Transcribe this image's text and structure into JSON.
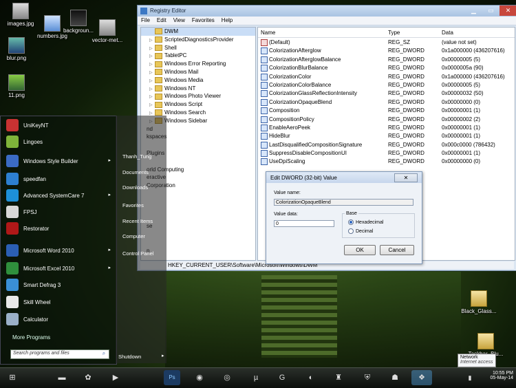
{
  "desktop_icons": [
    {
      "label": "images.jpg"
    },
    {
      "label": "numbers.jpg"
    },
    {
      "label": "backgroun..."
    },
    {
      "label": "vector-met..."
    },
    {
      "label": "blur.png"
    },
    {
      "label": "11.png"
    },
    {
      "label": "Black_Glass..."
    },
    {
      "label": "Taskbar_Blu..."
    }
  ],
  "regedit": {
    "title": "Registry Editor",
    "menu": [
      "File",
      "Edit",
      "View",
      "Favorites",
      "Help"
    ],
    "tree": [
      {
        "label": "DWM",
        "selected": true,
        "arrow": ""
      },
      {
        "label": "ScriptedDiagnosticsProvider",
        "arrow": "▷"
      },
      {
        "label": "Shell",
        "arrow": "▷"
      },
      {
        "label": "TabletPC",
        "arrow": "▷"
      },
      {
        "label": "Windows Error Reporting",
        "arrow": "▷"
      },
      {
        "label": "Windows Mail",
        "arrow": "▷"
      },
      {
        "label": "Windows Media",
        "arrow": "▷"
      },
      {
        "label": "Windows NT",
        "arrow": "▷"
      },
      {
        "label": "Windows Photo Viewer",
        "arrow": "▷"
      },
      {
        "label": "Windows Script",
        "arrow": "▷"
      },
      {
        "label": "Windows Search",
        "arrow": "▷"
      },
      {
        "label": "Windows Sidebar",
        "arrow": "▷"
      },
      {
        "label": "nd",
        "arrow": ""
      },
      {
        "label": "kspaces",
        "arrow": ""
      },
      {
        "label": "",
        "arrow": ""
      },
      {
        "label": "Plugins",
        "arrow": ""
      },
      {
        "label": "",
        "arrow": ""
      },
      {
        "label": "orld Computing",
        "arrow": ""
      },
      {
        "label": "eractive",
        "arrow": ""
      },
      {
        "label": "Corporation",
        "arrow": ""
      },
      {
        "label": "",
        "arrow": ""
      },
      {
        "label": "",
        "arrow": ""
      },
      {
        "label": "",
        "arrow": ""
      },
      {
        "label": "",
        "arrow": ""
      },
      {
        "label": "se",
        "arrow": ""
      },
      {
        "label": "",
        "arrow": ""
      },
      {
        "label": "",
        "arrow": ""
      },
      {
        "label": "n",
        "arrow": ""
      }
    ],
    "columns": {
      "name": "Name",
      "type": "Type",
      "data": "Data"
    },
    "values": [
      {
        "name": "(Default)",
        "type": "REG_SZ",
        "data": "(value not set)"
      },
      {
        "name": "ColorizationAfterglow",
        "type": "REG_DWORD",
        "data": "0x1a000000 (436207616)"
      },
      {
        "name": "ColorizationAfterglowBalance",
        "type": "REG_DWORD",
        "data": "0x00000005 (5)"
      },
      {
        "name": "ColorizationBlurBalance",
        "type": "REG_DWORD",
        "data": "0x0000005a (90)"
      },
      {
        "name": "ColorizationColor",
        "type": "REG_DWORD",
        "data": "0x1a000000 (436207616)"
      },
      {
        "name": "ColorizationColorBalance",
        "type": "REG_DWORD",
        "data": "0x00000005 (5)"
      },
      {
        "name": "ColorizationGlassReflectionIntensity",
        "type": "REG_DWORD",
        "data": "0x00000032 (50)"
      },
      {
        "name": "ColorizationOpaqueBlend",
        "type": "REG_DWORD",
        "data": "0x00000000 (0)"
      },
      {
        "name": "Composition",
        "type": "REG_DWORD",
        "data": "0x00000001 (1)"
      },
      {
        "name": "CompositionPolicy",
        "type": "REG_DWORD",
        "data": "0x00000002 (2)"
      },
      {
        "name": "EnableAeroPeek",
        "type": "REG_DWORD",
        "data": "0x00000001 (1)"
      },
      {
        "name": "HideBlur",
        "type": "REG_DWORD",
        "data": "0x00000001 (1)"
      },
      {
        "name": "LastDisqualifiedCompositionSignature",
        "type": "REG_DWORD",
        "data": "0x000c0000 (786432)"
      },
      {
        "name": "SuppressDisableCompositionUI",
        "type": "REG_DWORD",
        "data": "0x00000001 (1)"
      },
      {
        "name": "UseDpiScaling",
        "type": "REG_DWORD",
        "data": "0x00000000 (0)"
      }
    ],
    "status_path": "HKEY_CURRENT_USER\\Software\\Microsoft\\Windows\\DWM"
  },
  "dialog": {
    "title": "Edit DWORD (32-bit) Value",
    "value_name_label": "Value name:",
    "value_name": "ColorizationOpaqueBlend",
    "value_data_label": "Value data:",
    "value_data": "0",
    "base_label": "Base",
    "hex_label": "Hexadecimal",
    "dec_label": "Decimal",
    "ok_label": "OK",
    "cancel_label": "Cancel"
  },
  "start_menu": {
    "programs": [
      {
        "label": "UniKeyNT",
        "color": "#c83232",
        "arrow": ""
      },
      {
        "label": "Lingoes",
        "color": "#7fb43a",
        "arrow": ""
      },
      {
        "label": "Windows Style Builder",
        "color": "#3b6bc4",
        "arrow": "▸"
      },
      {
        "label": "speedfan",
        "color": "#2d7fd0",
        "arrow": ""
      },
      {
        "label": "Advanced SystemCare 7",
        "color": "#1d8fd8",
        "arrow": "▸"
      },
      {
        "label": "FPSJ",
        "color": "#d8d8d8",
        "arrow": ""
      },
      {
        "label": "Restorator",
        "color": "#b01818",
        "arrow": ""
      },
      {
        "label": "Microsoft Word 2010",
        "color": "#2b5fb4",
        "arrow": "▸"
      },
      {
        "label": "Microsoft Excel 2010",
        "color": "#2f8f3c",
        "arrow": "▸"
      },
      {
        "label": "Smart Defrag 3",
        "color": "#3a8fd6",
        "arrow": ""
      },
      {
        "label": "Skill Wheel",
        "color": "#e8e8e8",
        "arrow": ""
      },
      {
        "label": "Calculator",
        "color": "#9ab0c8",
        "arrow": ""
      }
    ],
    "all_programs": "More Programs",
    "right_links": [
      "Thanh_Tung",
      "Documents",
      "Downloads",
      "Favorites",
      "Recent Items",
      "Computer",
      "Control Panel"
    ],
    "search_placeholder": "Search programs and files",
    "shutdown_label": "Shutdown"
  },
  "taskbar": {
    "time": "10:55 PM",
    "date": "05-May-14",
    "tooltip_title": "Network",
    "tooltip_sub": "Internet access"
  }
}
